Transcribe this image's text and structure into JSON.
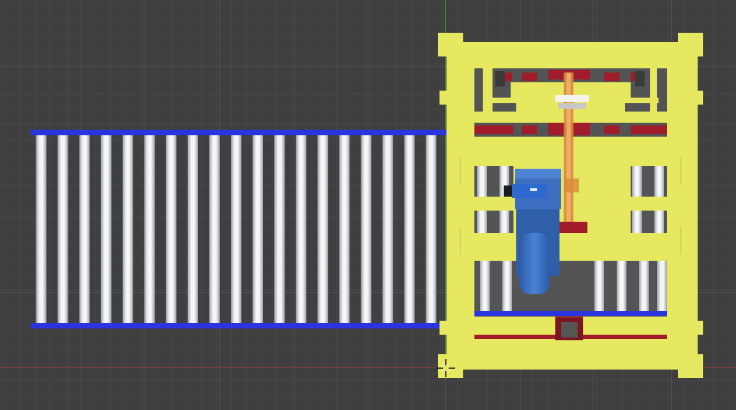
{
  "viewport": {
    "view": "top-orthographic",
    "background_color": "#3f3f3f",
    "grid": true,
    "axis_colors": {
      "x": "#9b3a3a",
      "y": "#4c8a3a"
    }
  },
  "scene": {
    "objects": [
      {
        "id": "roller-conveyor",
        "roller_count": 19,
        "roller_color": "#e6e9ef",
        "frame_color": "#2a35e0"
      },
      {
        "id": "yellow-frame",
        "color": "#e6e95f"
      },
      {
        "id": "red-brackets",
        "color": "#a01c2a"
      },
      {
        "id": "blue-motor",
        "color": "#3c6fc0"
      },
      {
        "id": "orange-belt",
        "color": "#d98a3c"
      },
      {
        "id": "3d-cursor",
        "icon": "crosshair-icon"
      }
    ]
  }
}
